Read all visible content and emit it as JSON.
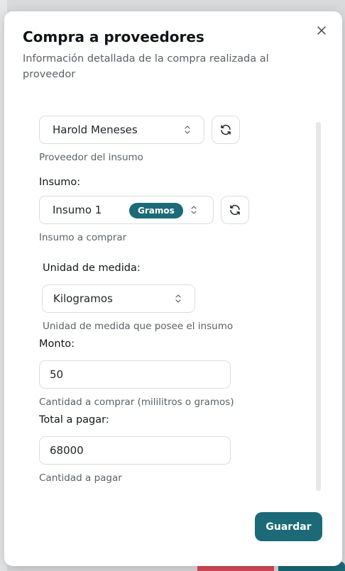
{
  "dialog": {
    "title": "Compra a proveedores",
    "subtitle": "Información detallada de la compra realizada al proveedor"
  },
  "proveedor": {
    "selected": "Harold Meneses",
    "help": "Proveedor del insumo"
  },
  "insumo": {
    "label": "Insumo:",
    "selected": "Insumo 1",
    "badge": "Gramos",
    "help": "Insumo a comprar"
  },
  "unidad": {
    "label": "Unidad de medida:",
    "selected": "Kilogramos",
    "help": "Unidad de medida que posee el insumo"
  },
  "monto": {
    "label": "Monto:",
    "value": "50",
    "help": "Cantidad a comprar (mililitros o gramos)"
  },
  "total": {
    "label": "Total a pagar:",
    "value": "68000",
    "help": "Cantidad a pagar"
  },
  "actions": {
    "save_label": "Guardar"
  },
  "colors": {
    "accent": "#1c6a78"
  }
}
